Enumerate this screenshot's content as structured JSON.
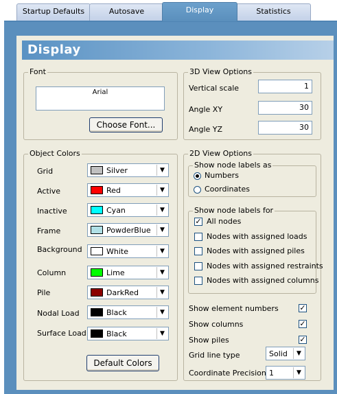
{
  "tabs": [
    "Startup Defaults",
    "Autosave",
    "Display",
    "Statistics"
  ],
  "header": {
    "title": "Display"
  },
  "font_group": {
    "legend": "Font",
    "sample": "Arial",
    "choose_button": "Choose Font..."
  },
  "view3d": {
    "legend": "3D View Options",
    "vertical_scale_label": "Vertical scale",
    "vertical_scale": "1",
    "angle_xy_label": "Angle XY",
    "angle_xy": "30",
    "angle_yz_label": "Angle YZ",
    "angle_yz": "30"
  },
  "object_colors": {
    "legend": "Object Colors",
    "items": [
      {
        "label": "Grid",
        "value": "Silver",
        "color": "#c0c0c0"
      },
      {
        "label": "Active",
        "value": "Red",
        "color": "#ff0000"
      },
      {
        "label": "Inactive",
        "value": "Cyan",
        "color": "#00ffff"
      },
      {
        "label": "Frame",
        "value": "PowderBlue",
        "color": "#b0e0e6"
      },
      {
        "label": "Background",
        "value": "White",
        "color": "#ffffff"
      },
      {
        "label": "Column",
        "value": "Lime",
        "color": "#00ff00"
      },
      {
        "label": "Pile",
        "value": "DarkRed",
        "color": "#8b0000"
      },
      {
        "label": "Nodal Load",
        "value": "Black",
        "color": "#000000"
      },
      {
        "label": "Surface Load",
        "value": "Black",
        "color": "#000000"
      }
    ],
    "default_button": "Default Colors"
  },
  "view2d": {
    "legend": "2D View Options",
    "labels_as": {
      "legend": "Show node labels as",
      "numbers": "Numbers",
      "coordinates": "Coordinates"
    },
    "labels_for": {
      "legend": "Show node labels for",
      "all_nodes": "All nodes",
      "loads": "Nodes with assigned loads",
      "piles": "Nodes with assigned piles",
      "restraints": "Nodes with assigned restraints",
      "columns": "Nodes with assigned columns"
    },
    "show_element_numbers": "Show element numbers",
    "show_columns": "Show columns",
    "show_piles": "Show piles",
    "grid_line_type_label": "Grid line type",
    "grid_line_type": "Solid",
    "coord_precision_label": "Coordinate Precision",
    "coord_precision": "1"
  },
  "colors": {
    "panel_blue": "#5b8fbd",
    "header_blue": "#5a92c3",
    "form_bg": "#eeecdf"
  }
}
